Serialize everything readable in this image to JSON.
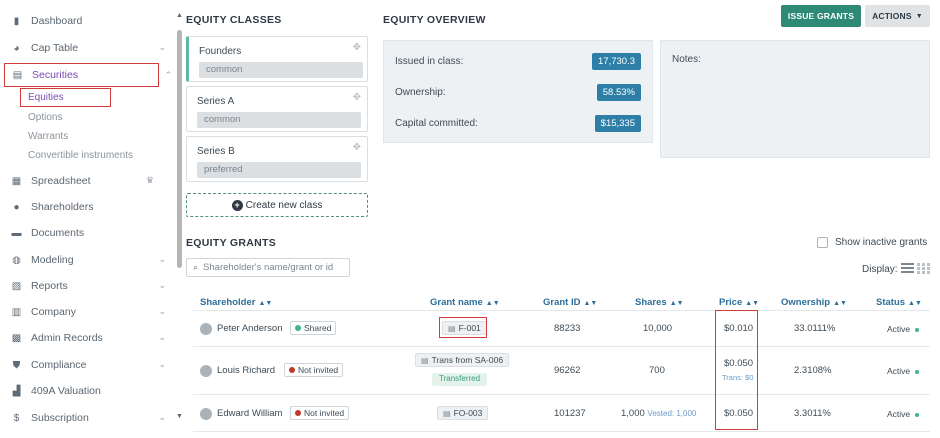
{
  "sidebar": {
    "items": [
      {
        "label": "Dashboard",
        "icon": "dashboard-icon",
        "chevron": false
      },
      {
        "label": "Cap Table",
        "icon": "pie-chart-icon",
        "chevron": true
      },
      {
        "label": "Securities",
        "icon": "clipboard-icon",
        "chevron": true,
        "active": true
      },
      {
        "label": "Spreadsheet",
        "icon": "spreadsheet-icon",
        "chevron": false,
        "crown": true
      },
      {
        "label": "Shareholders",
        "icon": "person-icon",
        "chevron": false
      },
      {
        "label": "Documents",
        "icon": "folder-icon",
        "chevron": false
      },
      {
        "label": "Modeling",
        "icon": "lightbulb-icon",
        "chevron": true
      },
      {
        "label": "Reports",
        "icon": "report-icon",
        "chevron": true
      },
      {
        "label": "Company",
        "icon": "building-icon",
        "chevron": true
      },
      {
        "label": "Admin Records",
        "icon": "records-icon",
        "chevron": true
      },
      {
        "label": "Compliance",
        "icon": "shield-icon",
        "chevron": true
      },
      {
        "label": "409A Valuation",
        "icon": "valuation-icon",
        "chevron": false
      },
      {
        "label": "Subscription",
        "icon": "dollar-icon",
        "chevron": true
      }
    ],
    "securities_sub": [
      {
        "label": "Equities",
        "active": true
      },
      {
        "label": "Options"
      },
      {
        "label": "Warrants"
      },
      {
        "label": "Convertible instruments"
      }
    ]
  },
  "equity_classes": {
    "title": "EQUITY CLASSES",
    "classes": [
      {
        "name": "Founders",
        "type": "common"
      },
      {
        "name": "Series A",
        "type": "common"
      },
      {
        "name": "Series B",
        "type": "preferred"
      }
    ],
    "create_label": "Create new class"
  },
  "overview": {
    "title": "EQUITY OVERVIEW",
    "rows": [
      {
        "label": "Issued in class:",
        "value": "17,730.3"
      },
      {
        "label": "Ownership:",
        "value": "58.53%"
      },
      {
        "label": "Capital committed:",
        "value": "$15,335"
      }
    ],
    "notes_label": "Notes:"
  },
  "toolbar": {
    "issue_grants": "ISSUE GRANTS",
    "actions": "ACTIONS"
  },
  "grants": {
    "title": "EQUITY GRANTS",
    "search_placeholder": "Shareholder's name/grant or id",
    "show_inactive": "Show inactive grants",
    "display_label": "Display:",
    "columns": [
      "Shareholder",
      "Grant name",
      "Grant ID",
      "Shares",
      "Price",
      "Ownership",
      "Status"
    ],
    "rows": [
      {
        "shareholder": "Peter Anderson",
        "invite": "Shared",
        "invite_color": "#3fb58e",
        "grant": "F-001",
        "grant_id": "88233",
        "shares": "10,000",
        "price": "$0.010",
        "ownership": "33.0111%",
        "status": "Active"
      },
      {
        "shareholder": "Louis Richard",
        "invite": "Not invited",
        "invite_color": "#c0392b",
        "grant": "Trans from SA-006",
        "grant_sub": "Transferred",
        "grant_id": "96262",
        "shares": "700",
        "price": "$0.050",
        "price_sub": "Trans: $0",
        "ownership": "2.3108%",
        "status": "Active"
      },
      {
        "shareholder": "Edward William",
        "invite": "Not invited",
        "invite_color": "#c0392b",
        "grant": "FO-003",
        "grant_id": "101237",
        "shares": "1,000",
        "shares_sub": "Vested: 1,000",
        "price": "$0.050",
        "ownership": "3.3011%",
        "status": "Active"
      }
    ]
  },
  "colors": {
    "accent": "#2e8a76",
    "badge": "#2e7fa8",
    "active_nav": "#7a4bb5",
    "highlight": "#d43b3b"
  }
}
